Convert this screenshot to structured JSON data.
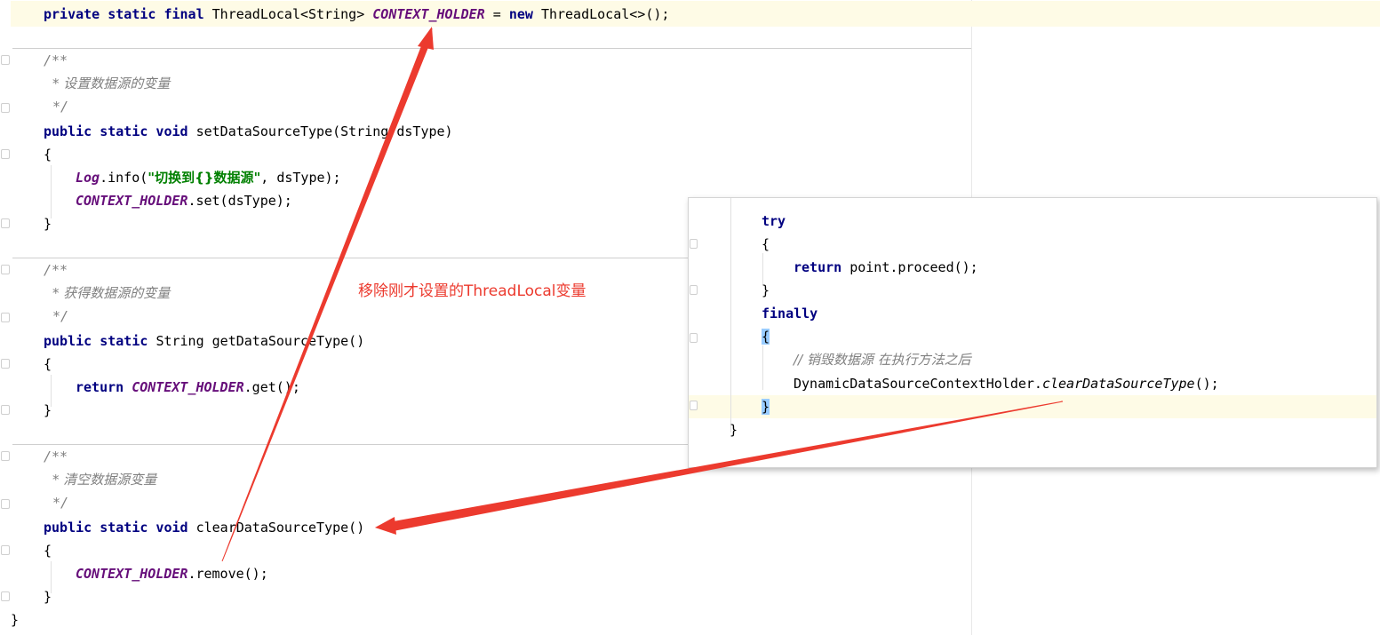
{
  "code": {
    "line_field": {
      "kw": "private static final",
      "type": "ThreadLocal<String>",
      "field": "CONTEXT_HOLDER",
      "eq": "=",
      "kw_new": "new",
      "init": "ThreadLocal<>();"
    },
    "comment_open": "/**",
    "comment_close": "*/",
    "set_method": {
      "comment": "* 设置数据源的变量",
      "sig_kw": "public static void",
      "sig_rest": "setDataSourceType(String dsType)",
      "open": "{",
      "log_obj": "Log",
      "log_call": ".info(",
      "log_str": "\"切换到{}数据源\"",
      "log_rest": ", dsType);",
      "holder": "CONTEXT_HOLDER",
      "holder_call": ".set(dsType);",
      "close": "}"
    },
    "get_method": {
      "comment": "* 获得数据源的变量",
      "sig_kw": "public static",
      "sig_rest": "String getDataSourceType()",
      "open": "{",
      "ret_kw": "return",
      "holder": "CONTEXT_HOLDER",
      "holder_call": ".get();",
      "close": "}"
    },
    "clear_method": {
      "comment": "* 清空数据源变量",
      "sig_kw": "public static void",
      "sig_rest": "clearDataSourceType()",
      "open": "{",
      "holder": "CONTEXT_HOLDER",
      "holder_call": ".remove();",
      "close": "}"
    },
    "class_close": "}"
  },
  "popup": {
    "try_kw": "try",
    "open1": "{",
    "ret_kw": "return",
    "ret_rest": "point.proceed();",
    "close1": "}",
    "finally_kw": "finally",
    "open2": "{",
    "comment": "// 销毁数据源 在执行方法之后",
    "call_obj": "DynamicDataSourceContextHolder.",
    "call_method": "clearDataSourceType",
    "call_end": "();",
    "close2": "}",
    "close3": "}"
  },
  "annotation": "移除刚才设置的ThreadLocal变量",
  "colors": {
    "keyword": "#000080",
    "field": "#660e7a",
    "comment": "#808080",
    "string": "#008000",
    "annotation": "#ec3a2e",
    "current_line": "#fefbe6"
  }
}
